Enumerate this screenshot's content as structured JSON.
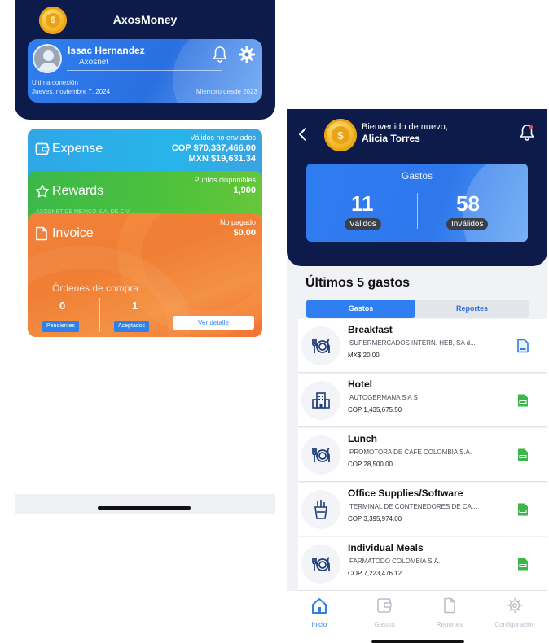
{
  "left": {
    "app_title": "AxosMoney",
    "coin_symbol": "$",
    "profile": {
      "name": "Issac Hernandez",
      "company": "Axosnet",
      "last_connection_label": "Ultima conexión",
      "last_connection_date": "Jueves, noviembre 7, 2024",
      "member_since": "Miembro desde 2023"
    },
    "expense_card": {
      "title": "Expense",
      "status": "Válidos no enviados",
      "value_cop": "COP $70,337,466.00",
      "value_mxn": "MXN $19,631.34",
      "color": "#2fa6e6"
    },
    "rewards_card": {
      "title": "Rewards",
      "status": "Puntos disponibles",
      "points": "1,900",
      "ghost_text": "AXOSNET DE MEXICO S.A. DE C.V.",
      "color": "#4ec23b"
    },
    "invoice_card": {
      "title": "Invoice",
      "status": "No pagado",
      "amount": "$0.00",
      "orders_title": "Órdenes de compra",
      "pending_count": "0",
      "pending_label": "Pendientes",
      "accepted_count": "1",
      "accepted_label": "Aceptados",
      "detail_button": "Ver detalle",
      "color": "#f07e34"
    }
  },
  "right": {
    "welcome": "Bienvenido de nuevo,",
    "user_name": "Alicia Torres",
    "gastos_card": {
      "title": "Gastos",
      "valid_count": "11",
      "valid_label": "Válidos",
      "invalid_count": "58",
      "invalid_label": "Inválidos"
    },
    "section_title": "Últimos 5 gastos",
    "segments": [
      "Gastos",
      "Reportes"
    ],
    "expenses": [
      {
        "title": "Breakfast",
        "merchant": "SUPERMERCADOS INTERN. HEB, SA d...",
        "amount": "MX$ 20.00",
        "icon": "restaurant-icon",
        "doc": "pdf-doc-icon"
      },
      {
        "title": "Hotel",
        "merchant": "AUTOGERMANA S A S",
        "amount": "COP 1,435,675.50",
        "icon": "hotel-icon",
        "doc": "xml-doc-icon"
      },
      {
        "title": "Lunch",
        "merchant": "PROMOTORA DE CAFE COLOMBIA S.A.",
        "amount": "COP 28,500.00",
        "icon": "restaurant-icon",
        "doc": "xml-doc-icon"
      },
      {
        "title": "Office Supplies/Software",
        "merchant": "TERMINAL DE CONTENEDORES DE CA...",
        "amount": "COP 3,395,974.00",
        "icon": "office-supplies-icon",
        "doc": "xml-doc-icon"
      },
      {
        "title": "Individual Meals",
        "merchant": "FARMATODO COLOMBIA S.A.",
        "amount": "COP 7,223,476.12",
        "icon": "restaurant-icon",
        "doc": "xml-doc-icon"
      }
    ],
    "tabs": [
      {
        "label": "Inicio",
        "icon": "home-icon",
        "active": true
      },
      {
        "label": "Gastos",
        "icon": "wallet-icon",
        "active": false
      },
      {
        "label": "Reportes",
        "icon": "document-icon",
        "active": false
      },
      {
        "label": "Configuración",
        "icon": "gear-icon",
        "active": false
      }
    ],
    "colors": {
      "navy": "#0d1b4b",
      "accent": "#2f7ff0",
      "doc_green": "#3cb54a",
      "doc_blue": "#2f7fe8"
    }
  }
}
